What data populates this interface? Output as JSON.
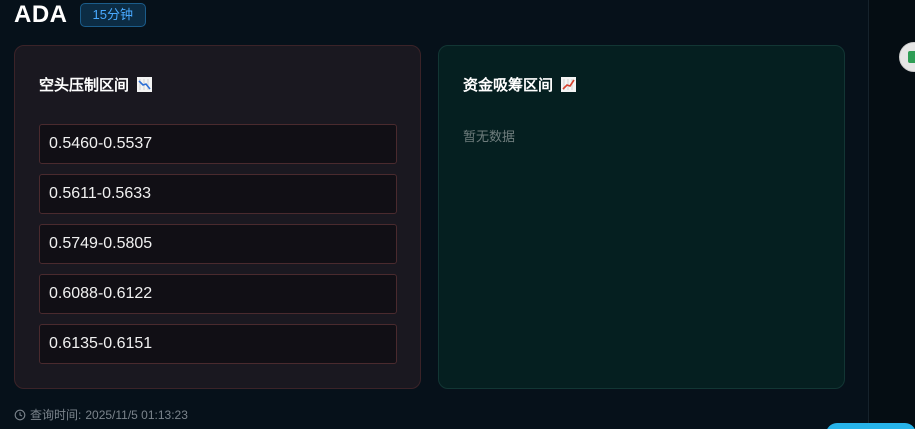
{
  "header": {
    "symbol": "ADA",
    "timeframe": "15分钟"
  },
  "resistance_panel": {
    "title": "空头压制区间",
    "icon": "chart-decreasing-icon",
    "ranges": [
      "0.5460-0.5537",
      "0.5611-0.5633",
      "0.5749-0.5805",
      "0.6088-0.6122",
      "0.6135-0.6151"
    ]
  },
  "support_panel": {
    "title": "资金吸筹区间",
    "icon": "chart-increasing-icon",
    "empty_text": "暂无数据"
  },
  "footer": {
    "label": "查询时间:",
    "timestamp": "2025/11/5 01:13:23"
  },
  "colors": {
    "accent": "#49a9ff",
    "resistance_border": "#4a2a2e",
    "support_bg": "#051f20",
    "side_tab_green": "#2f9e56",
    "float_button": "#27b3e9"
  }
}
